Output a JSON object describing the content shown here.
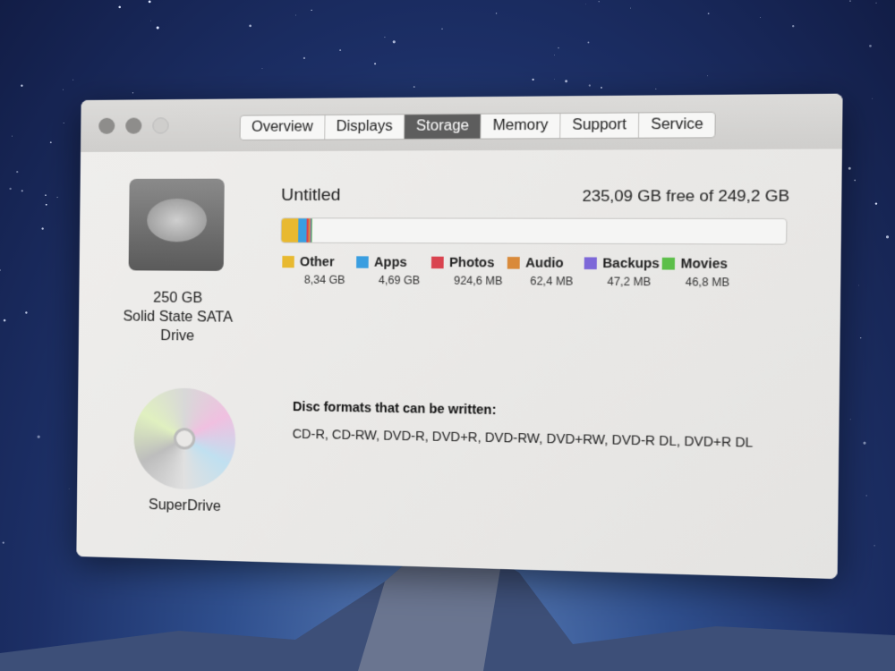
{
  "window": {
    "tabs": [
      {
        "label": "Overview"
      },
      {
        "label": "Displays"
      },
      {
        "label": "Storage",
        "active": true
      },
      {
        "label": "Memory"
      },
      {
        "label": "Support"
      },
      {
        "label": "Service"
      }
    ]
  },
  "drive": {
    "capacity": "250 GB",
    "type": "Solid State SATA",
    "type2": "Drive",
    "icon": "hard-drive-icon"
  },
  "superdrive": {
    "label": "SuperDrive",
    "icon": "optical-disc-icon"
  },
  "volume": {
    "name": "Untitled",
    "free": "235,09 GB free of 249,2 GB",
    "categories": [
      {
        "name": "Other",
        "size": "8,34 GB",
        "color": "#e8b930",
        "gb": 8.34
      },
      {
        "name": "Apps",
        "size": "4,69 GB",
        "color": "#3a9ee0",
        "gb": 4.69
      },
      {
        "name": "Photos",
        "size": "924,6 MB",
        "color": "#d9434f",
        "gb": 0.9246
      },
      {
        "name": "Audio",
        "size": "62,4 MB",
        "color": "#d98a3a",
        "gb": 0.0624
      },
      {
        "name": "Backups",
        "size": "47,2 MB",
        "color": "#7d68d8",
        "gb": 0.0472
      },
      {
        "name": "Movies",
        "size": "46,8 MB",
        "color": "#5cbf4a",
        "gb": 0.0468
      }
    ],
    "total_gb": 249.2
  },
  "disc": {
    "heading": "Disc formats that can be written:",
    "formats": "CD-R, CD-RW, DVD-R, DVD+R, DVD-RW, DVD+RW, DVD-R DL, DVD+R DL"
  }
}
